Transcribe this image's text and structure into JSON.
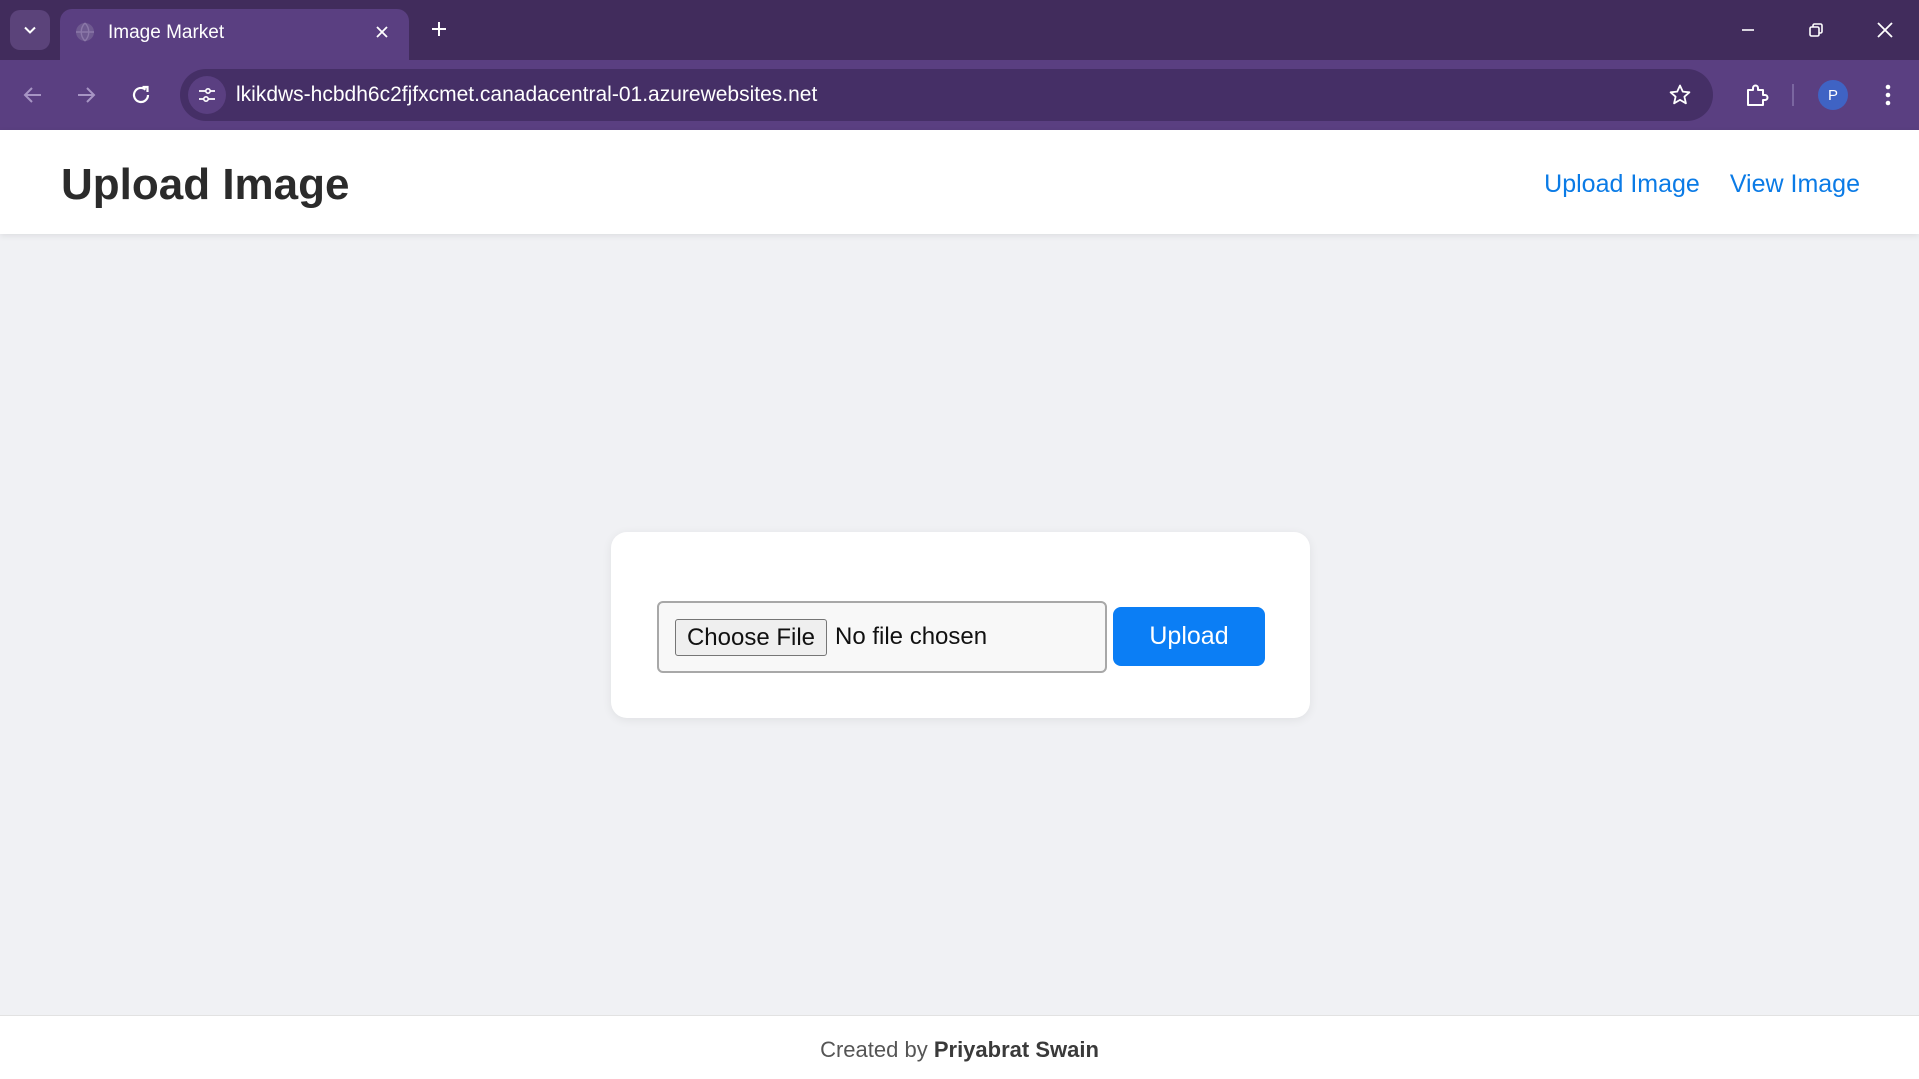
{
  "browser": {
    "tab_title": "Image Market",
    "url": "lkikdws-hcbdh6c2fjfxcmet.canadacentral-01.azurewebsites.net",
    "profile_initial": "P",
    "icons": [
      "tab-search-icon",
      "globe-icon",
      "close-icon",
      "plus-icon",
      "minimize-icon",
      "restore-icon",
      "back-icon",
      "forward-icon",
      "reload-icon",
      "site-info-icon",
      "star-icon",
      "extensions-icon",
      "more-icon"
    ]
  },
  "header": {
    "title": "Upload Image",
    "nav": {
      "upload": "Upload Image",
      "view": "View Image"
    }
  },
  "upload_form": {
    "choose_file": "Choose File",
    "file_status": "No file chosen",
    "submit": "Upload"
  },
  "footer": {
    "prefix": "Created by",
    "author": "Priyabrat Swain"
  },
  "colors": {
    "chrome_dark": "#412c5c",
    "chrome_toolbar": "#5a3f81",
    "link": "#0b7be6",
    "button": "#0b7ef5",
    "page_bg": "#f0f1f4"
  }
}
